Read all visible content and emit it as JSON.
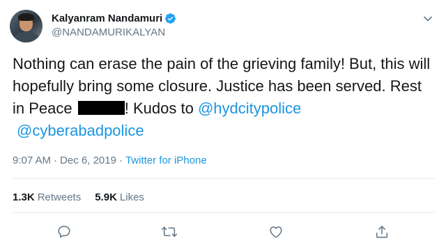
{
  "author": {
    "display_name": "Kalyanram Nandamuri",
    "handle": "@NANDAMURIKALYAN",
    "verified": true
  },
  "tweet": {
    "text_part1": "Nothing can erase the pain of the grieving family! But, this will hopefully bring some closure. Justice has been served. Rest in Peace",
    "text_part2": "! Kudos to",
    "mention_1": "@hydcitypolice",
    "mention_2": "@cyberabadpolice"
  },
  "meta": {
    "time": "9:07 AM",
    "separator_1": "·",
    "date": "Dec 6, 2019",
    "separator_2": "·",
    "source": "Twitter for iPhone"
  },
  "stats": {
    "retweets_count": "1.3K",
    "retweets_label": "Retweets",
    "likes_count": "5.9K",
    "likes_label": "Likes"
  },
  "icons": {
    "verified": "verified-badge-icon",
    "more": "chevron-down-icon",
    "reply": "reply-icon",
    "retweet": "retweet-icon",
    "like": "heart-icon",
    "share": "share-icon"
  },
  "colors": {
    "text": "#14171a",
    "secondary": "#657786",
    "link": "#1b95e0",
    "divider": "#e6ecf0",
    "verified": "#1da1f2"
  }
}
